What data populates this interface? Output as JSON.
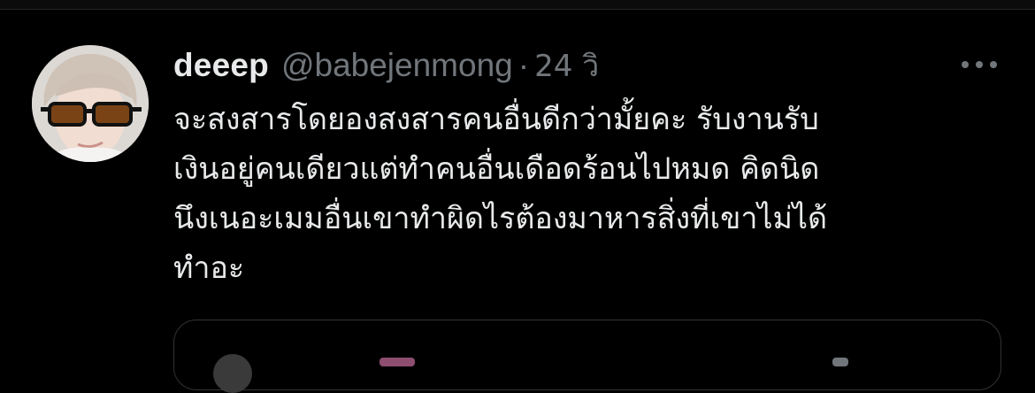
{
  "tweet": {
    "display_name": "deeep",
    "handle": "@babejenmong",
    "separator": "·",
    "time": "24 วิ",
    "text": "จะสงสารโดยองสงสารคนอื่นดีกว่ามั้ยคะ รับงานรับ\nเงินอยู่คนเดียวแต่ทำคนอื่นเดือดร้อนไปหมด คิดนิด\nนึงเนอะเมมอื่นเขาทำผิดไรต้องมาหารสิ่งที่เขาไม่ได้\nทำอะ",
    "more_icon": "more-horizontal-icon"
  },
  "colors": {
    "background": "#000000",
    "primary_text": "#e7e9ea",
    "secondary_text": "#71767b",
    "border": "#2f3336"
  }
}
